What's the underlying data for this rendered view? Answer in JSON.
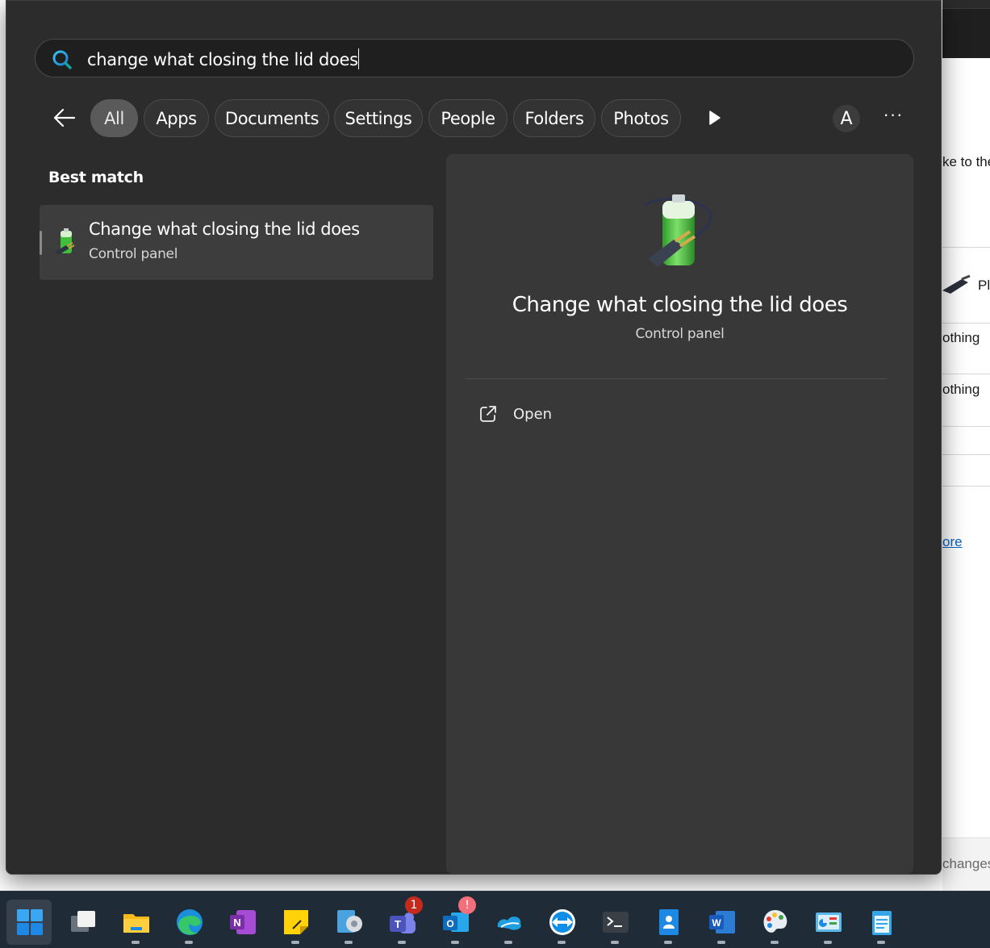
{
  "search": {
    "query": "change what closing the lid does"
  },
  "filters": {
    "tabs": [
      {
        "label": "All",
        "active": true
      },
      {
        "label": "Apps"
      },
      {
        "label": "Documents"
      },
      {
        "label": "Settings"
      },
      {
        "label": "People"
      },
      {
        "label": "Folders"
      },
      {
        "label": "Photos"
      }
    ],
    "avatar_letter": "A",
    "more_label": "···"
  },
  "results": {
    "heading": "Best match",
    "best_match": {
      "title": "Change what closing the lid does",
      "subtitle": "Control panel",
      "icon": "battery-plug-icon"
    }
  },
  "preview": {
    "title": "Change what closing the lid does",
    "subtitle": "Control panel",
    "actions": [
      {
        "label": "Open",
        "icon": "open-external-icon"
      }
    ]
  },
  "background_app": {
    "text1": "ke to the",
    "text2": "Pl",
    "text3": "othing",
    "text4": "othing",
    "link": "ore",
    "footer": "changes"
  },
  "taskbar": {
    "apps": [
      {
        "name": "start",
        "icon": "windows-start-icon"
      },
      {
        "name": "task-view",
        "icon": "task-view-icon"
      },
      {
        "name": "file-explorer",
        "icon": "folder-icon"
      },
      {
        "name": "edge",
        "icon": "edge-icon"
      },
      {
        "name": "onenote",
        "icon": "onenote-icon"
      },
      {
        "name": "sticky-notes",
        "icon": "sticky-notes-icon"
      },
      {
        "name": "network-app",
        "icon": "network-icon"
      },
      {
        "name": "teams",
        "icon": "teams-icon",
        "badge": "1"
      },
      {
        "name": "outlook",
        "icon": "outlook-icon",
        "badge": "!"
      },
      {
        "name": "zscaler",
        "icon": "cloud-icon"
      },
      {
        "name": "teamviewer",
        "icon": "teamviewer-icon"
      },
      {
        "name": "terminal",
        "icon": "terminal-icon"
      },
      {
        "name": "contacts",
        "icon": "contacts-icon"
      },
      {
        "name": "word",
        "icon": "word-icon"
      },
      {
        "name": "paint",
        "icon": "paint-icon"
      },
      {
        "name": "control-panel",
        "icon": "control-panel-icon"
      },
      {
        "name": "notepad",
        "icon": "notepad-icon"
      }
    ],
    "colors": {
      "background": "#202b38",
      "accent": "#0078d4"
    }
  }
}
